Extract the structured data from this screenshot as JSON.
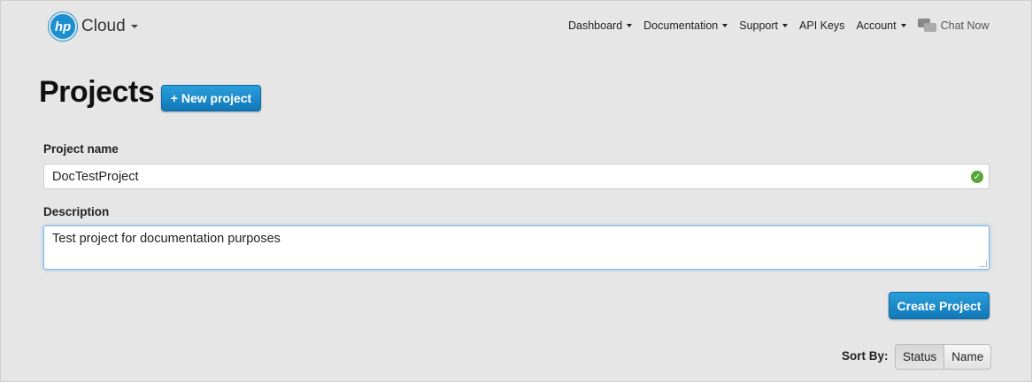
{
  "header": {
    "brand": "Cloud",
    "logo_text": "hp",
    "nav": [
      {
        "label": "Dashboard",
        "has_menu": true
      },
      {
        "label": "Documentation",
        "has_menu": true
      },
      {
        "label": "Support",
        "has_menu": true
      },
      {
        "label": "API Keys",
        "has_menu": false
      },
      {
        "label": "Account",
        "has_menu": true
      }
    ],
    "chat_label": "Chat Now"
  },
  "page": {
    "title": "Projects",
    "new_project_label": "+ New project"
  },
  "form": {
    "name_label": "Project name",
    "name_value": "DocTestProject",
    "description_label": "Description",
    "description_value": "Test project for documentation purposes",
    "create_label": "Create Project"
  },
  "sort": {
    "label": "Sort By:",
    "options": [
      "Status",
      "Name"
    ],
    "selected": "Status"
  },
  "colors": {
    "accent": "#1a8fd1",
    "valid": "#5aa739",
    "background": "#e6e6e6"
  }
}
